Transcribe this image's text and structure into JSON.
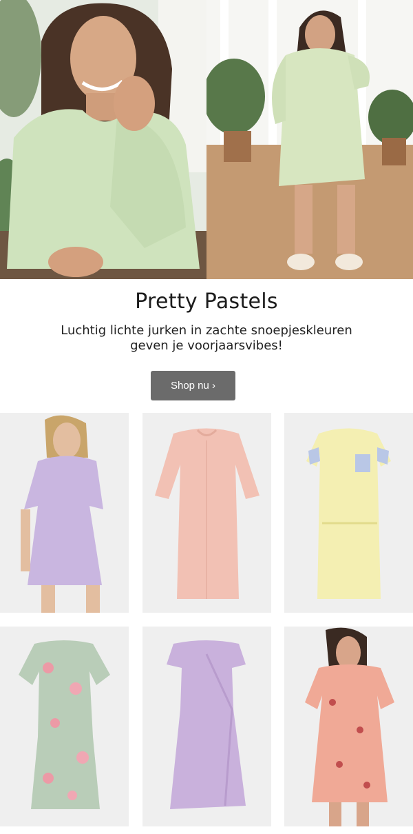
{
  "promo": {
    "title": "Pretty Pastels",
    "subtitle_line1": "Luchtig lichte jurken in zachte snoepjeskleuren",
    "subtitle_line2": "geven je voorjaarsvibes!",
    "cta_label": "Shop nu ›"
  },
  "hero": {
    "images": [
      {
        "name": "hero-image-model-green-top"
      },
      {
        "name": "hero-image-model-green-dress"
      }
    ]
  },
  "products": [
    {
      "name": "product-lilac-tshirt-dress",
      "color": "#c9b6e0"
    },
    {
      "name": "product-pink-dress",
      "color": "#f2c1b4"
    },
    {
      "name": "product-yellow-striped-dress",
      "color": "#f4efb2"
    },
    {
      "name": "product-floral-sage-dress",
      "color": "#b9cdb8"
    },
    {
      "name": "product-lilac-dotted-wrap-dress",
      "color": "#c9b1dc"
    },
    {
      "name": "product-coral-floral-dress",
      "color": "#f0a996"
    }
  ]
}
